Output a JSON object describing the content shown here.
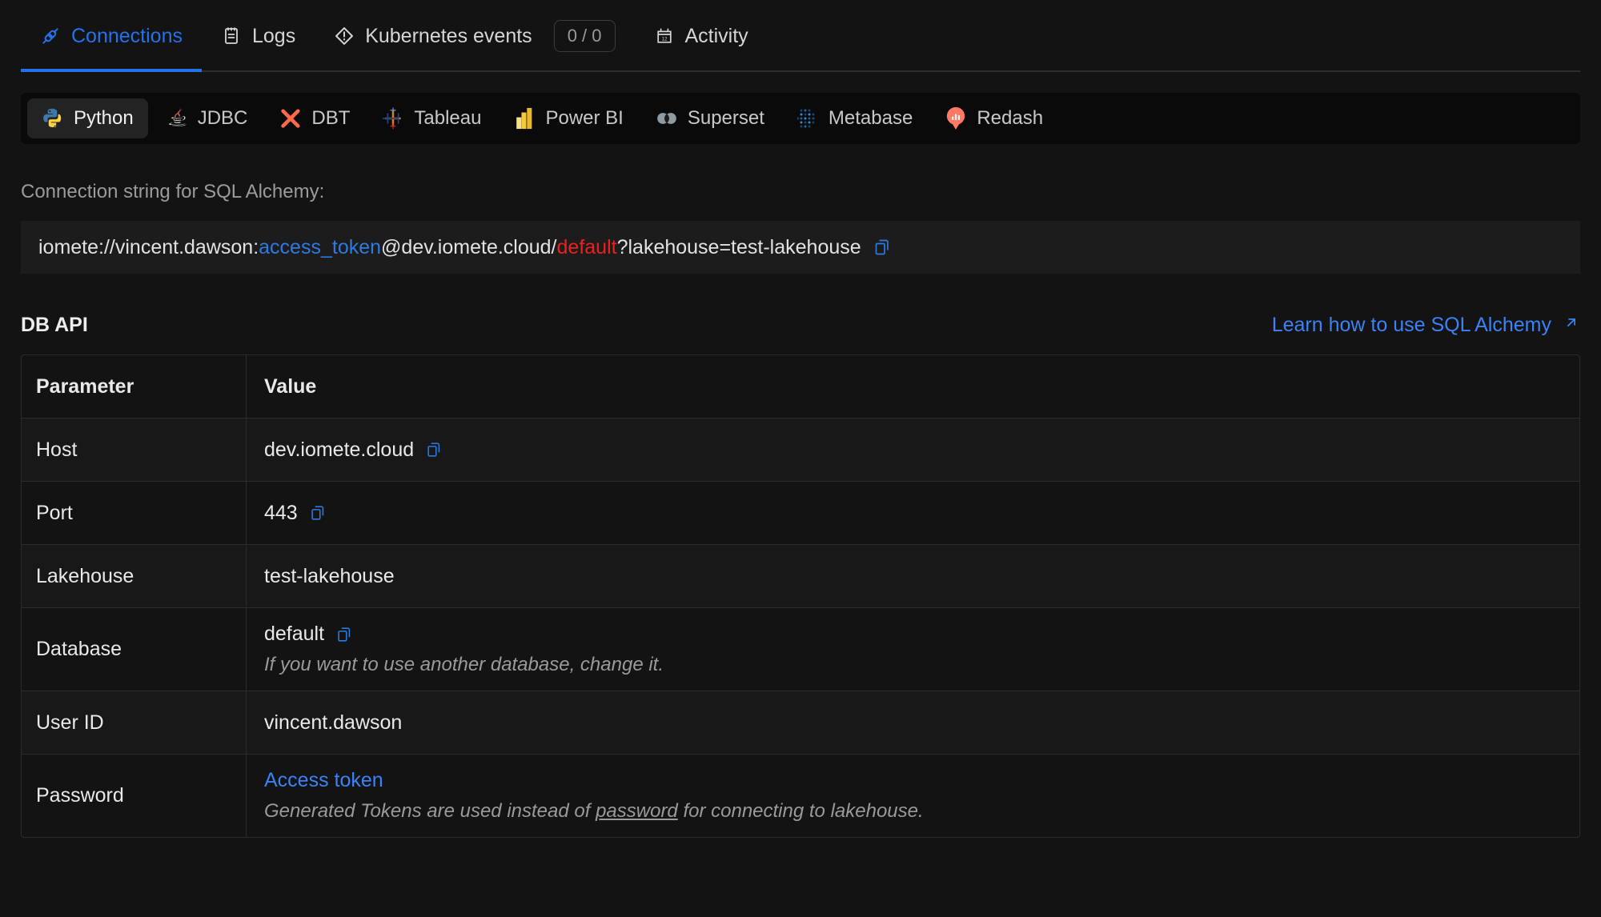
{
  "tabs": [
    {
      "label": "Connections",
      "icon": "connections-plug-icon",
      "active": true
    },
    {
      "label": "Logs",
      "icon": "logs-notebook-icon",
      "active": false
    },
    {
      "label": "Kubernetes events",
      "icon": "kubernetes-alert-icon",
      "active": false,
      "badge": "0 / 0"
    },
    {
      "label": "Activity",
      "icon": "activity-calendar-icon",
      "active": false
    }
  ],
  "integrations": [
    {
      "label": "Python",
      "icon": "python-icon",
      "active": true
    },
    {
      "label": "JDBC",
      "icon": "java-icon",
      "active": false
    },
    {
      "label": "DBT",
      "icon": "dbt-icon",
      "active": false
    },
    {
      "label": "Tableau",
      "icon": "tableau-icon",
      "active": false
    },
    {
      "label": "Power BI",
      "icon": "powerbi-icon",
      "active": false
    },
    {
      "label": "Superset",
      "icon": "superset-icon",
      "active": false
    },
    {
      "label": "Metabase",
      "icon": "metabase-icon",
      "active": false
    },
    {
      "label": "Redash",
      "icon": "redash-icon",
      "active": false
    }
  ],
  "connection_string": {
    "label": "Connection string for SQL Alchemy:",
    "prefix": "iomete://vincent.dawson:",
    "token": "access_token",
    "middle": "@dev.iomete.cloud/",
    "database": "default",
    "suffix": "?lakehouse=test-lakehouse",
    "copy_icon": "copy-icon"
  },
  "section": {
    "title": "DB API",
    "link_label": "Learn how to use SQL Alchemy",
    "link_icon": "external-link-arrow-icon"
  },
  "table": {
    "headers": {
      "parameter": "Parameter",
      "value": "Value"
    },
    "rows": [
      {
        "parameter": "Host",
        "value": "dev.iomete.cloud",
        "copy": true,
        "note": ""
      },
      {
        "parameter": "Port",
        "value": "443",
        "copy": true,
        "note": ""
      },
      {
        "parameter": "Lakehouse",
        "value": "test-lakehouse",
        "copy": false,
        "note": ""
      },
      {
        "parameter": "Database",
        "value": "default",
        "copy": true,
        "note_pre": "If you want to use another database, change it.",
        "note_u": "",
        "note_post": ""
      },
      {
        "parameter": "User ID",
        "value": "vincent.dawson",
        "copy": false,
        "note": ""
      },
      {
        "parameter": "Password",
        "value": "Access token",
        "copy": false,
        "value_is_link": true,
        "note_pre": "Generated Tokens are used instead of ",
        "note_u": "password",
        "note_post": " for connecting to lakehouse."
      }
    ]
  },
  "colors": {
    "page_bg": "#131313",
    "accent_blue": "#2272eb",
    "link_blue": "#3b82f6",
    "danger_red": "#f01f1f",
    "strip_bg": "#0a0a0a",
    "box_bg": "#1c1c1c",
    "border": "#2c2c2c"
  }
}
